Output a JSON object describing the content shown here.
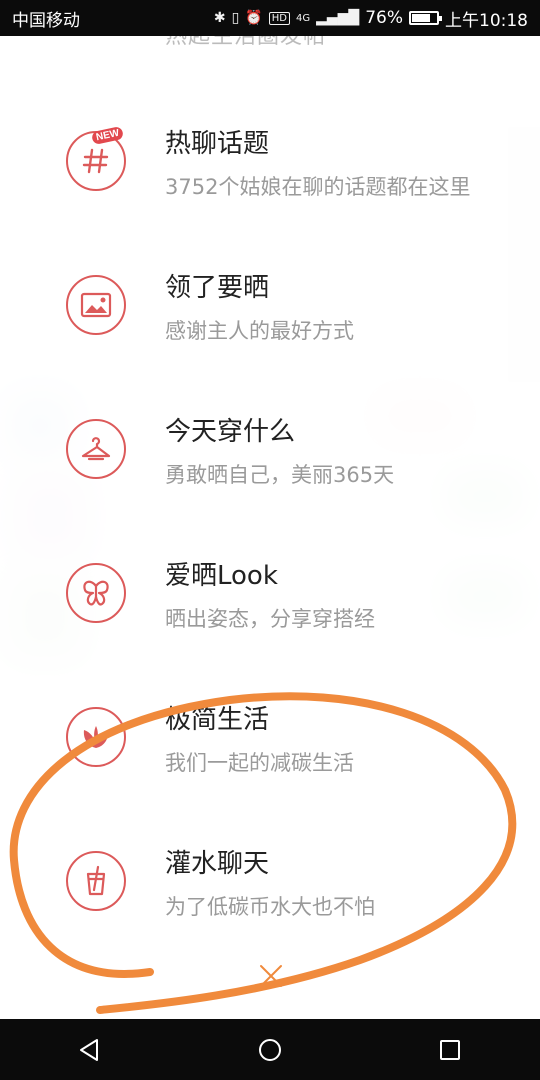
{
  "status_bar": {
    "carrier": "中国移动",
    "network": "4G",
    "battery": "76%",
    "battery_level": 0.76,
    "time": "上午10:18"
  },
  "partial_header_text": "热起生活圈发帖",
  "menu": [
    {
      "title": "热聊话题",
      "subtitle": "3752个姑娘在聊的话题都在这里",
      "icon": "hash-icon",
      "badge": "NEW"
    },
    {
      "title": "领了要晒",
      "subtitle": "感谢主人的最好方式",
      "icon": "image-icon"
    },
    {
      "title": "今天穿什么",
      "subtitle": "勇敢晒自己，美丽365天",
      "icon": "hanger-icon"
    },
    {
      "title": "爱晒Look",
      "subtitle": "晒出姿态，分享穿搭经",
      "icon": "butterfly-icon"
    },
    {
      "title": "极简生活",
      "subtitle": "我们一起的减碳生活",
      "icon": "leaf-icon"
    },
    {
      "title": "灌水聊天",
      "subtitle": "为了低碳币水大也不怕",
      "icon": "drink-cup-icon"
    }
  ],
  "colors": {
    "accent": "#dc5a5a",
    "annotation": "#f08a3c",
    "title": "#222222",
    "subtitle": "#9a9a9a"
  }
}
